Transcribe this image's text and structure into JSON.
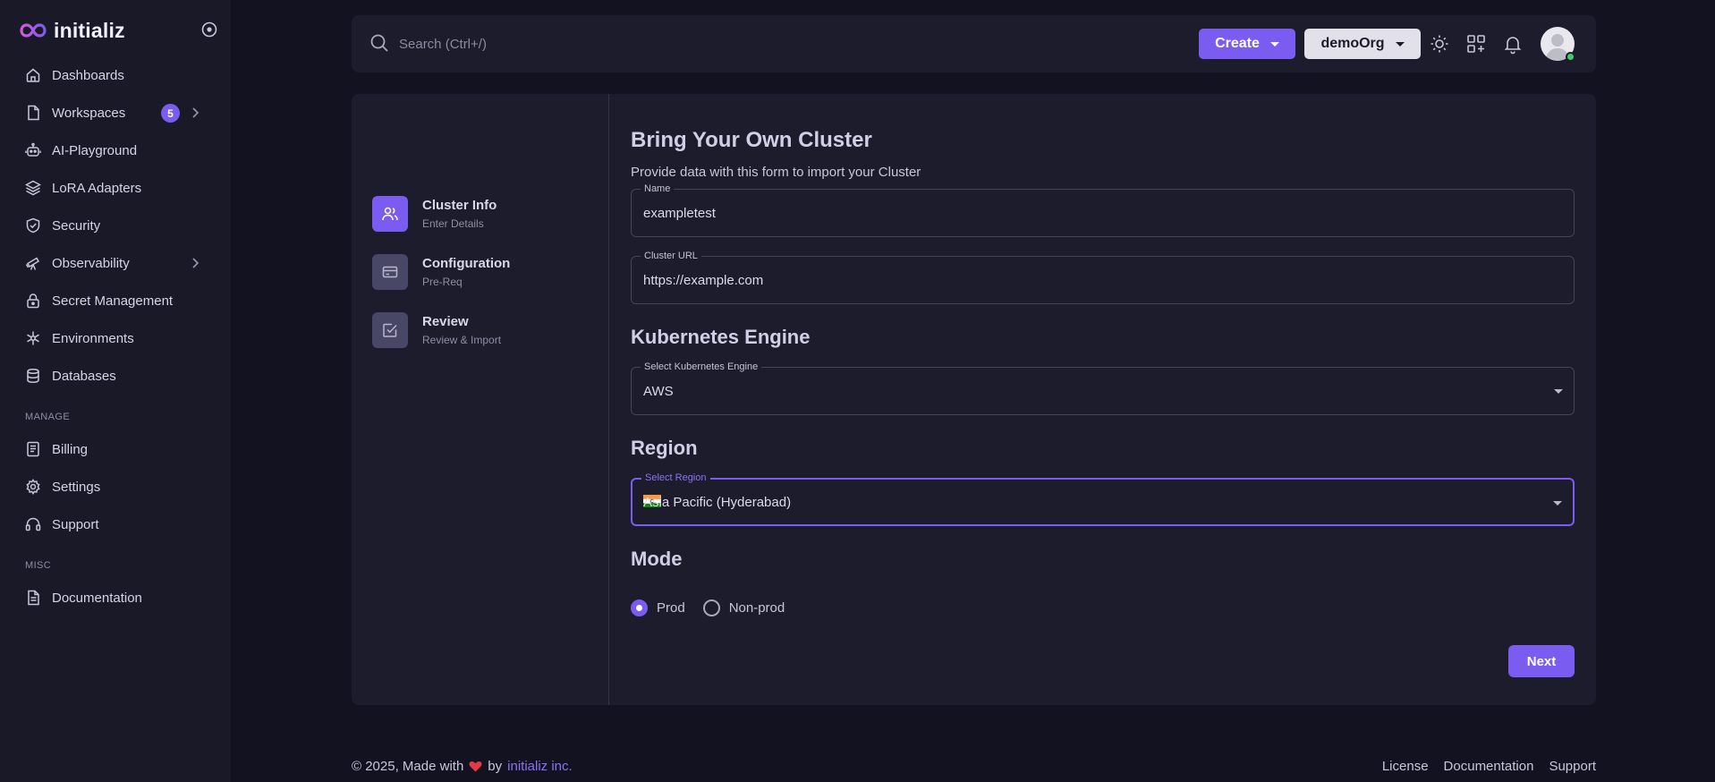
{
  "brand": {
    "name": "initializ"
  },
  "sidebar": {
    "items": [
      {
        "label": "Dashboards",
        "icon": "home-icon"
      },
      {
        "label": "Workspaces",
        "icon": "file-icon",
        "badge": "5"
      },
      {
        "label": "AI-Playground",
        "icon": "robot-icon"
      },
      {
        "label": "LoRA Adapters",
        "icon": "layers-icon"
      },
      {
        "label": "Security",
        "icon": "shield-icon"
      },
      {
        "label": "Observability",
        "icon": "telescope-icon"
      },
      {
        "label": "Secret Management",
        "icon": "lock-icon"
      },
      {
        "label": "Environments",
        "icon": "snowflake-icon"
      },
      {
        "label": "Databases",
        "icon": "database-icon"
      }
    ],
    "manage_title": "MANAGE",
    "manage_items": [
      {
        "label": "Billing",
        "icon": "receipt-icon"
      },
      {
        "label": "Settings",
        "icon": "gear-icon"
      },
      {
        "label": "Support",
        "icon": "headset-icon"
      }
    ],
    "misc_title": "MISC",
    "misc_items": [
      {
        "label": "Documentation",
        "icon": "document-icon"
      }
    ]
  },
  "header": {
    "search_placeholder": "Search (Ctrl+/)",
    "create_label": "Create",
    "org_label": "demoOrg"
  },
  "steps": [
    {
      "title": "Cluster Info",
      "subtitle": "Enter Details",
      "icon": "users-icon",
      "active": true
    },
    {
      "title": "Configuration",
      "subtitle": "Pre-Req",
      "icon": "card-icon",
      "active": false
    },
    {
      "title": "Review",
      "subtitle": "Review & Import",
      "icon": "check-square-icon",
      "active": false
    }
  ],
  "form": {
    "title": "Bring Your Own Cluster",
    "subtitle": "Provide data with this form to import your Cluster",
    "name_label": "Name",
    "name_value": "exampletest",
    "url_label": "Cluster URL",
    "url_value": "https://example.com",
    "engine_heading": "Kubernetes Engine",
    "engine_label": "Select Kubernetes Engine",
    "engine_value": "AWS",
    "region_heading": "Region",
    "region_label": "Select Region",
    "region_value": "Asia Pacific (Hyderabad)",
    "region_flag": "india-flag-icon",
    "mode_heading": "Mode",
    "modes": [
      {
        "label": "Prod",
        "checked": true
      },
      {
        "label": "Non-prod",
        "checked": false
      }
    ],
    "next_label": "Next"
  },
  "footer": {
    "copyright": "© 2025, Made with",
    "by": "by",
    "company": "initializ inc.",
    "links": [
      "License",
      "Documentation",
      "Support"
    ]
  },
  "colors": {
    "accent": "#7b5cf0",
    "background": "#131221",
    "surface": "#1d1c2c",
    "sidebar": "#1a1928",
    "online": "#3ecf6a"
  }
}
